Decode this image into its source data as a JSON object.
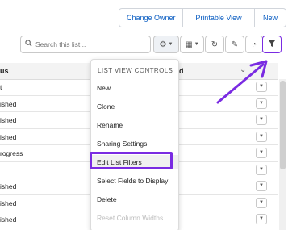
{
  "top_actions": {
    "change_owner": "Change Owner",
    "printable_view": "Printable View",
    "new": "New"
  },
  "toolbar": {
    "search_placeholder": "Search this list...",
    "search_icon": "search-icon",
    "settings_icon": "gear-icon",
    "display_icon": "table-icon",
    "refresh_icon": "refresh-icon",
    "edit_icon": "pencil-icon",
    "chart_icon": "chart-icon",
    "filter_icon": "filter-icon"
  },
  "table": {
    "header_col1": "us",
    "header_col2": "ed",
    "rows": [
      {
        "status": "t"
      },
      {
        "status": "ished"
      },
      {
        "status": "ished"
      },
      {
        "status": "ished"
      },
      {
        "status": "rogress"
      },
      {
        "status": ""
      },
      {
        "status": "ished"
      },
      {
        "status": "ished"
      },
      {
        "status": "ished"
      },
      {
        "status": ""
      }
    ]
  },
  "menu": {
    "heading": "LIST VIEW CONTROLS",
    "items": [
      {
        "label": "New"
      },
      {
        "label": "Clone"
      },
      {
        "label": "Rename"
      },
      {
        "label": "Sharing Settings"
      },
      {
        "label": "Edit List Filters"
      },
      {
        "label": "Select Fields to Display"
      },
      {
        "label": "Delete"
      },
      {
        "label": "Reset Column Widths"
      }
    ]
  },
  "colors": {
    "accent": "#7a2be2",
    "link": "#0a5dc2"
  }
}
